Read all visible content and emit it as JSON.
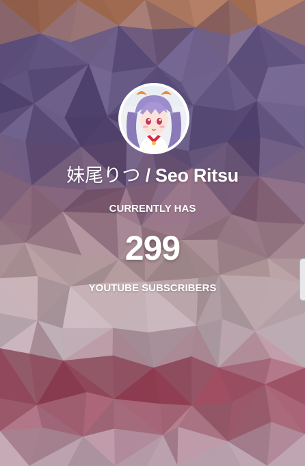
{
  "channel": {
    "name_jp": "妹尾りつ",
    "separator": " / ",
    "name_en": "Seo Ritsu"
  },
  "stats": {
    "prefix_label": "CURRENTLY HAS",
    "subscriber_count": "299",
    "suffix_label": "YOUTUBE SUBSCRIBERS"
  },
  "theme": {
    "text_color": "#ffffff",
    "background_style": "low-poly pattern",
    "palette": [
      "#6c5e86",
      "#c98a5a",
      "#a89ab8",
      "#d9c3bf",
      "#8c2f45"
    ]
  },
  "icons": {
    "avatar": "anime-avatar-icon"
  }
}
